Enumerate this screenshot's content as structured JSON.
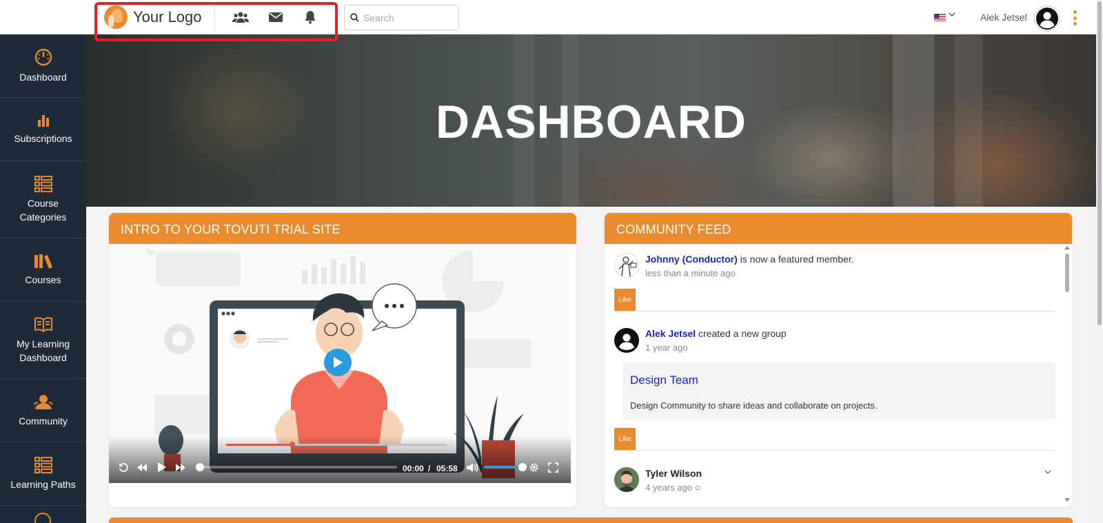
{
  "header": {
    "logo_text": "Your Logo",
    "search_placeholder": "Search",
    "user_name": "Alek Jetsel"
  },
  "sidebar": {
    "items": [
      {
        "label": "Dashboard",
        "icon": "gauge-icon"
      },
      {
        "label": "Subscriptions",
        "icon": "bar-chart-icon"
      },
      {
        "label": "Course Categories",
        "icon": "category-list-icon"
      },
      {
        "label": "Courses",
        "icon": "books-icon"
      },
      {
        "label": "My Learning Dashboard",
        "icon": "open-book-icon"
      },
      {
        "label": "Community",
        "icon": "community-user-icon"
      },
      {
        "label": "Learning Paths",
        "icon": "path-list-icon"
      }
    ]
  },
  "hero": {
    "title": "DASHBOARD"
  },
  "intro_card": {
    "title": "INTRO TO YOUR TOVUTI TRIAL SITE",
    "video": {
      "current_time": "00:00",
      "separator": "/",
      "duration": "05:58",
      "progress": 0,
      "volume": 1
    }
  },
  "feed_card": {
    "title": "COMMUNITY FEED",
    "like_label": "Like",
    "entries": [
      {
        "actor": "Johnny (Conductor)",
        "action": " is now a featured member.",
        "time": "less than a minute ago"
      },
      {
        "actor": "Alek Jetsel",
        "action": " created a new group",
        "time": "1 year ago",
        "group": {
          "name": "Design Team",
          "description": "Design Community to share ideas and collaborate on projects."
        }
      },
      {
        "actor": "Tyler Wilson",
        "action": "",
        "time": "4 years ago"
      }
    ]
  },
  "colors": {
    "accent": "#e98a2c",
    "sidebar": "#1f2a38",
    "link": "#1a1fb5",
    "highlight": "#ee1c24"
  }
}
